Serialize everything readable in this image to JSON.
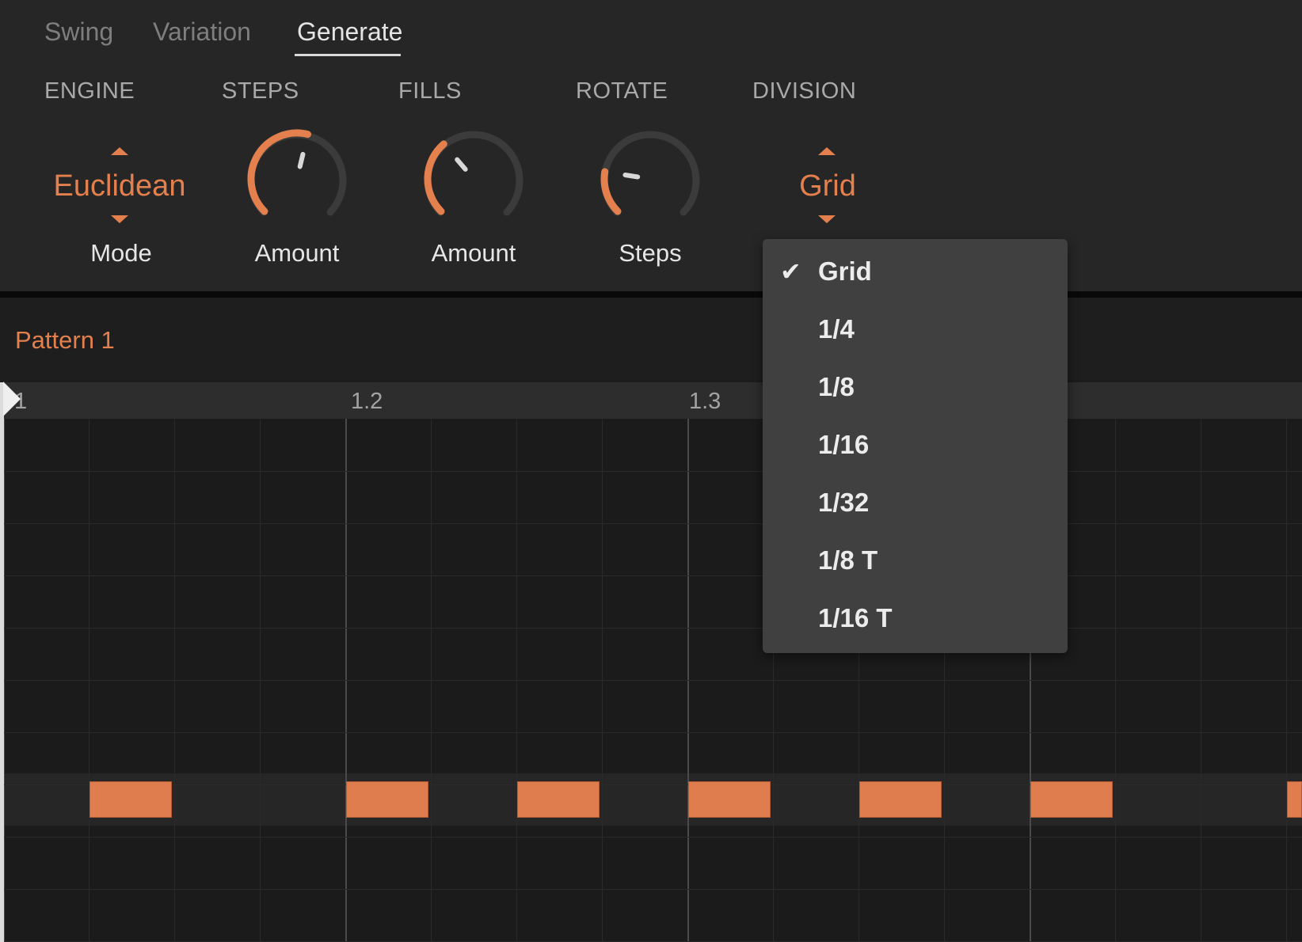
{
  "tabs": [
    {
      "label": "Swing"
    },
    {
      "label": "Variation"
    },
    {
      "label": "Generate",
      "active": true
    }
  ],
  "sections": {
    "engine": {
      "label": "ENGINE",
      "value": "Euclidean",
      "sub": "Mode"
    },
    "steps": {
      "label": "STEPS",
      "sub": "Amount",
      "knob_level": 0.55
    },
    "fills": {
      "label": "FILLS",
      "sub": "Amount",
      "knob_level": 0.35
    },
    "rotate": {
      "label": "ROTATE",
      "sub": "Steps",
      "knob_level": 0.2
    },
    "division": {
      "label": "DIVISION",
      "value": "Grid"
    }
  },
  "pattern": {
    "title": "Pattern 1"
  },
  "ruler": {
    "markers": [
      "1",
      "1.2",
      "1.3"
    ]
  },
  "dropdown": {
    "selected": "Grid",
    "items": [
      "Grid",
      "1/4",
      "1/8",
      "1/16",
      "1/32",
      "1/8 T",
      "1/16 T"
    ]
  },
  "notes": {
    "steps_on": [
      1,
      4,
      6,
      8,
      10,
      12,
      15
    ],
    "total_visible_steps": 16
  },
  "colors": {
    "accent": "#e3804e",
    "background": "#1c1c1c",
    "panel": "#262626"
  },
  "icons": {
    "check": "check-icon",
    "arrow_up": "arrow-up-icon",
    "arrow_down": "arrow-down-icon",
    "playhead": "playhead-icon"
  }
}
